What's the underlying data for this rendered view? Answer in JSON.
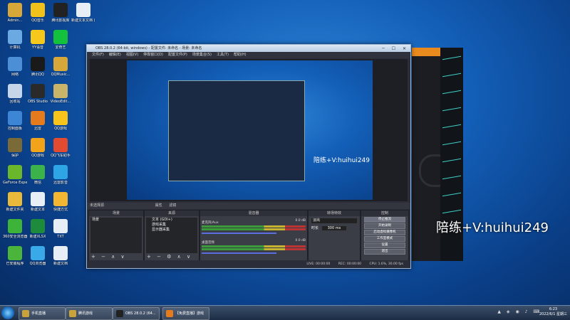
{
  "desktop_icons": [
    {
      "label": "Admin...",
      "color": "#d8a73a"
    },
    {
      "label": "QQ音乐",
      "color": "#f2c11a"
    },
    {
      "label": "腾讯影视库",
      "color": "#222"
    },
    {
      "label": "新建文本文档 (1).txt",
      "color": "#e8eef5"
    },
    {
      "label": "计算机",
      "color": "#6aa9e2"
    },
    {
      "label": "YY语音",
      "color": "#f6c81b"
    },
    {
      "label": "爱奇艺",
      "color": "#13c13c"
    },
    {
      "label": "网络",
      "color": "#4c8fd6"
    },
    {
      "label": "腾讯QQ",
      "color": "#1a1a1a"
    },
    {
      "label": "QQMusic...",
      "color": "#d8a73a"
    },
    {
      "label": "回收站",
      "color": "#c5d6e8"
    },
    {
      "label": "OBS Studio",
      "color": "#2a2a2a"
    },
    {
      "label": "VideoEdit...",
      "color": "#c9b56a"
    },
    {
      "label": "控制面板",
      "color": "#3d86d6"
    },
    {
      "label": "迅雷",
      "color": "#e57b1c"
    },
    {
      "label": "QQ游戏",
      "color": "#f7c41b"
    },
    {
      "label": "保护",
      "color": "#7a6a38"
    },
    {
      "label": "QQ游戏",
      "color": "#f3a31a"
    },
    {
      "label": "QQ飞车助手",
      "color": "#e24b2f"
    },
    {
      "label": "GeForce Experience",
      "color": "#6ab72b"
    },
    {
      "label": "微信",
      "color": "#3cb34a"
    },
    {
      "label": "迅雷影音",
      "color": "#2ea6e5"
    },
    {
      "label": "新建文件夹",
      "color": "#e8b93b"
    },
    {
      "label": "新建文本",
      "color": "#e8eef5"
    },
    {
      "label": "快捷方式",
      "color": "#f2b632"
    },
    {
      "label": "360安全浏览器",
      "color": "#3db33a"
    },
    {
      "label": "新建XLSX",
      "color": "#1e8a3c"
    },
    {
      "label": "TXT",
      "color": "#e8eef5"
    },
    {
      "label": "已安装程序",
      "color": "#4ab53a"
    },
    {
      "label": "QQ浏览器",
      "color": "#3aa9e8"
    },
    {
      "label": "新建文档",
      "color": "#e8eef5"
    }
  ],
  "obs": {
    "title": "OBS 28.0.2 (64-bit, windows) - 配置文件: 未命名 - 场景: 未命名",
    "menu": [
      "文件(F)",
      "编辑(E)",
      "视图(V)",
      "停靠窗口(D)",
      "配置文件(P)",
      "场景集合(S)",
      "工具(T)",
      "帮助(H)"
    ],
    "dock_bar": "未选择源",
    "dock_bar_buttons": [
      "属性",
      "滤镜"
    ],
    "scenes": {
      "header": "场景",
      "items": [
        "场景"
      ]
    },
    "sources": {
      "header": "来源",
      "items": [
        "文本 (GDI+)",
        "游戏采集",
        "显示器采集"
      ]
    },
    "mixer": {
      "header": "混音器",
      "tracks": [
        {
          "name": "麦克风/Aux",
          "db": "0.0 dB"
        },
        {
          "name": "桌面音频",
          "db": "0.0 dB"
        }
      ]
    },
    "transitions": {
      "header": "转场特效",
      "type": "淡出",
      "duration_label": "时长",
      "duration": "300 ms"
    },
    "controls": {
      "header": "控制",
      "buttons": [
        "停止推流",
        "开始录制",
        "启动虚拟摄像机",
        "工作室模式",
        "设置",
        "退出"
      ]
    },
    "status": [
      "LIVE: 00:00:00",
      "REC: 00:00:00",
      "CPU: 1.6%, 30.00 fps"
    ]
  },
  "overlay_text": "陪练+V:huihui249",
  "inner_overlay_text": "陪练+V:huihui249",
  "taskbar": {
    "buttons": [
      {
        "label": "手机直播",
        "color": "#c8a23a"
      },
      {
        "label": "腾讯游戏",
        "color": "#c8a23a"
      },
      {
        "label": "OBS 28.0.2 (64...",
        "color": "#222"
      },
      {
        "label": "【免费直播】游戏",
        "color": "#e57b1c"
      }
    ],
    "clock_time": "6:23",
    "clock_date": "2022/6/1 星期三"
  }
}
